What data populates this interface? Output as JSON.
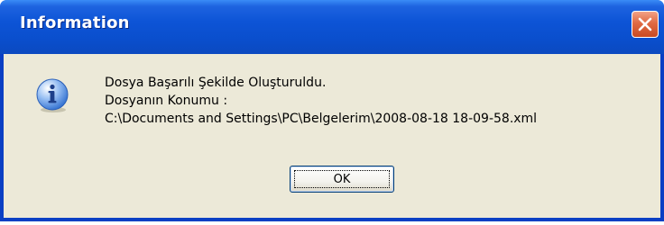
{
  "window": {
    "title": "Information",
    "close_label": "Close"
  },
  "message": {
    "icon": "information-icon",
    "lines": [
      "Dosya Başarılı Şekilde Oluşturuldu.",
      "Dosyanın Konumu :",
      "C:\\Documents and Settings\\PC\\Belgelerim\\2008-08-18 18-09-58.xml"
    ]
  },
  "buttons": {
    "ok_label": "OK"
  },
  "colors": {
    "titlebar": "#0a4fce",
    "client_background": "#ece9d8",
    "close_button": "#e06a43",
    "info_icon": "#2f6fd0"
  }
}
